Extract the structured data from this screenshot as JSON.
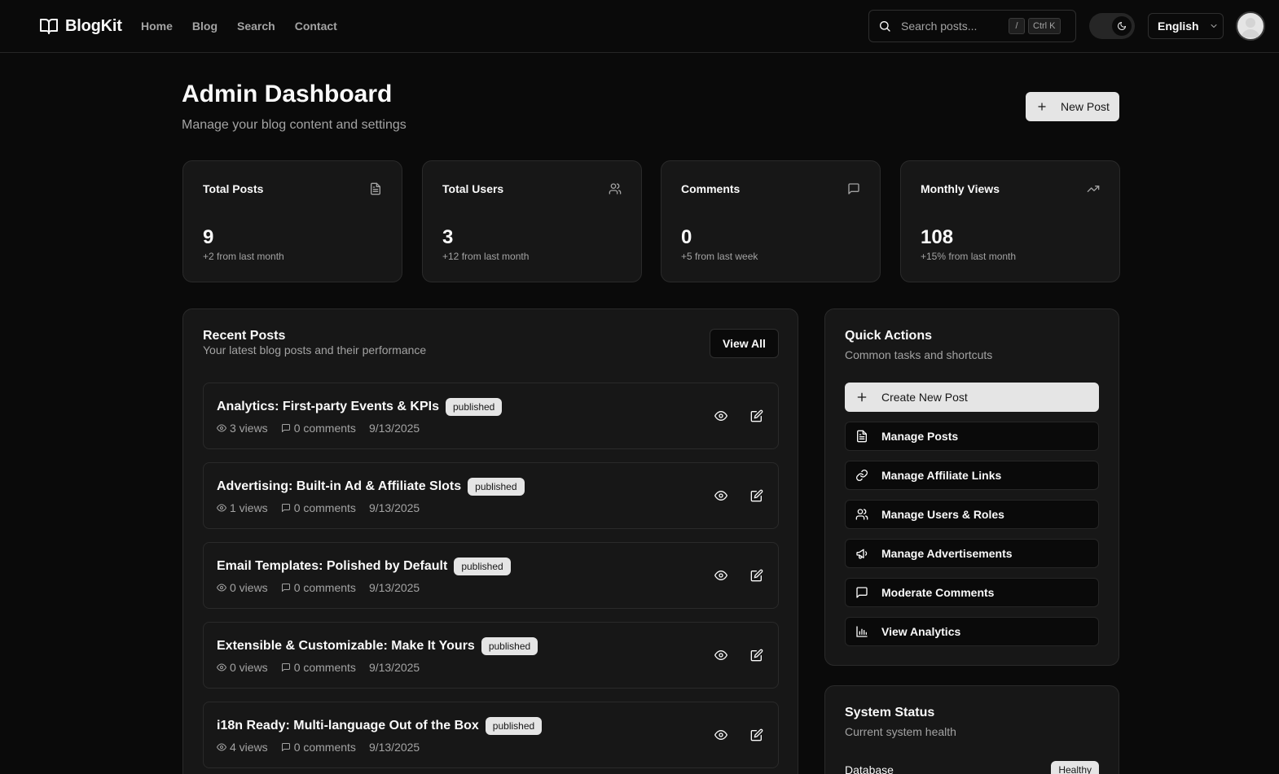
{
  "header": {
    "brand": "BlogKit",
    "nav": [
      "Home",
      "Blog",
      "Search",
      "Contact"
    ],
    "search_placeholder": "Search posts...",
    "shortcut_slash": "/",
    "shortcut_ctrl": "Ctrl K",
    "language": "English"
  },
  "page": {
    "title": "Admin Dashboard",
    "subtitle": "Manage your blog content and settings",
    "new_post_label": "New Post"
  },
  "stats": [
    {
      "title": "Total Posts",
      "value": "9",
      "note": "+2 from last month",
      "icon": "file-icon"
    },
    {
      "title": "Total Users",
      "value": "3",
      "note": "+12 from last month",
      "icon": "users-icon"
    },
    {
      "title": "Comments",
      "value": "0",
      "note": "+5 from last week",
      "icon": "message-icon"
    },
    {
      "title": "Monthly Views",
      "value": "108",
      "note": "+15% from last month",
      "icon": "trending-up-icon"
    }
  ],
  "recent": {
    "title": "Recent Posts",
    "subtitle": "Your latest blog posts and their performance",
    "view_all": "View All",
    "posts": [
      {
        "title": "Analytics: First-party Events & KPIs",
        "status": "published",
        "views": "3 views",
        "comments": "0 comments",
        "date": "9/13/2025"
      },
      {
        "title": "Advertising: Built-in Ad & Affiliate Slots",
        "status": "published",
        "views": "1 views",
        "comments": "0 comments",
        "date": "9/13/2025"
      },
      {
        "title": "Email Templates: Polished by Default",
        "status": "published",
        "views": "0 views",
        "comments": "0 comments",
        "date": "9/13/2025"
      },
      {
        "title": "Extensible & Customizable: Make It Yours",
        "status": "published",
        "views": "0 views",
        "comments": "0 comments",
        "date": "9/13/2025"
      },
      {
        "title": "i18n Ready: Multi-language Out of the Box",
        "status": "published",
        "views": "4 views",
        "comments": "0 comments",
        "date": "9/13/2025"
      }
    ]
  },
  "quick_actions": {
    "title": "Quick Actions",
    "subtitle": "Common tasks and shortcuts",
    "items": [
      {
        "label": "Create New Post",
        "icon": "plus-icon"
      },
      {
        "label": "Manage Posts",
        "icon": "file-icon"
      },
      {
        "label": "Manage Affiliate Links",
        "icon": "link-icon"
      },
      {
        "label": "Manage Users & Roles",
        "icon": "users-icon"
      },
      {
        "label": "Manage Advertisements",
        "icon": "megaphone-icon"
      },
      {
        "label": "Moderate Comments",
        "icon": "message-icon"
      },
      {
        "label": "View Analytics",
        "icon": "bar-chart-icon"
      }
    ]
  },
  "system_status": {
    "title": "System Status",
    "subtitle": "Current system health",
    "rows": [
      {
        "label": "Database",
        "status": "Healthy"
      }
    ]
  }
}
